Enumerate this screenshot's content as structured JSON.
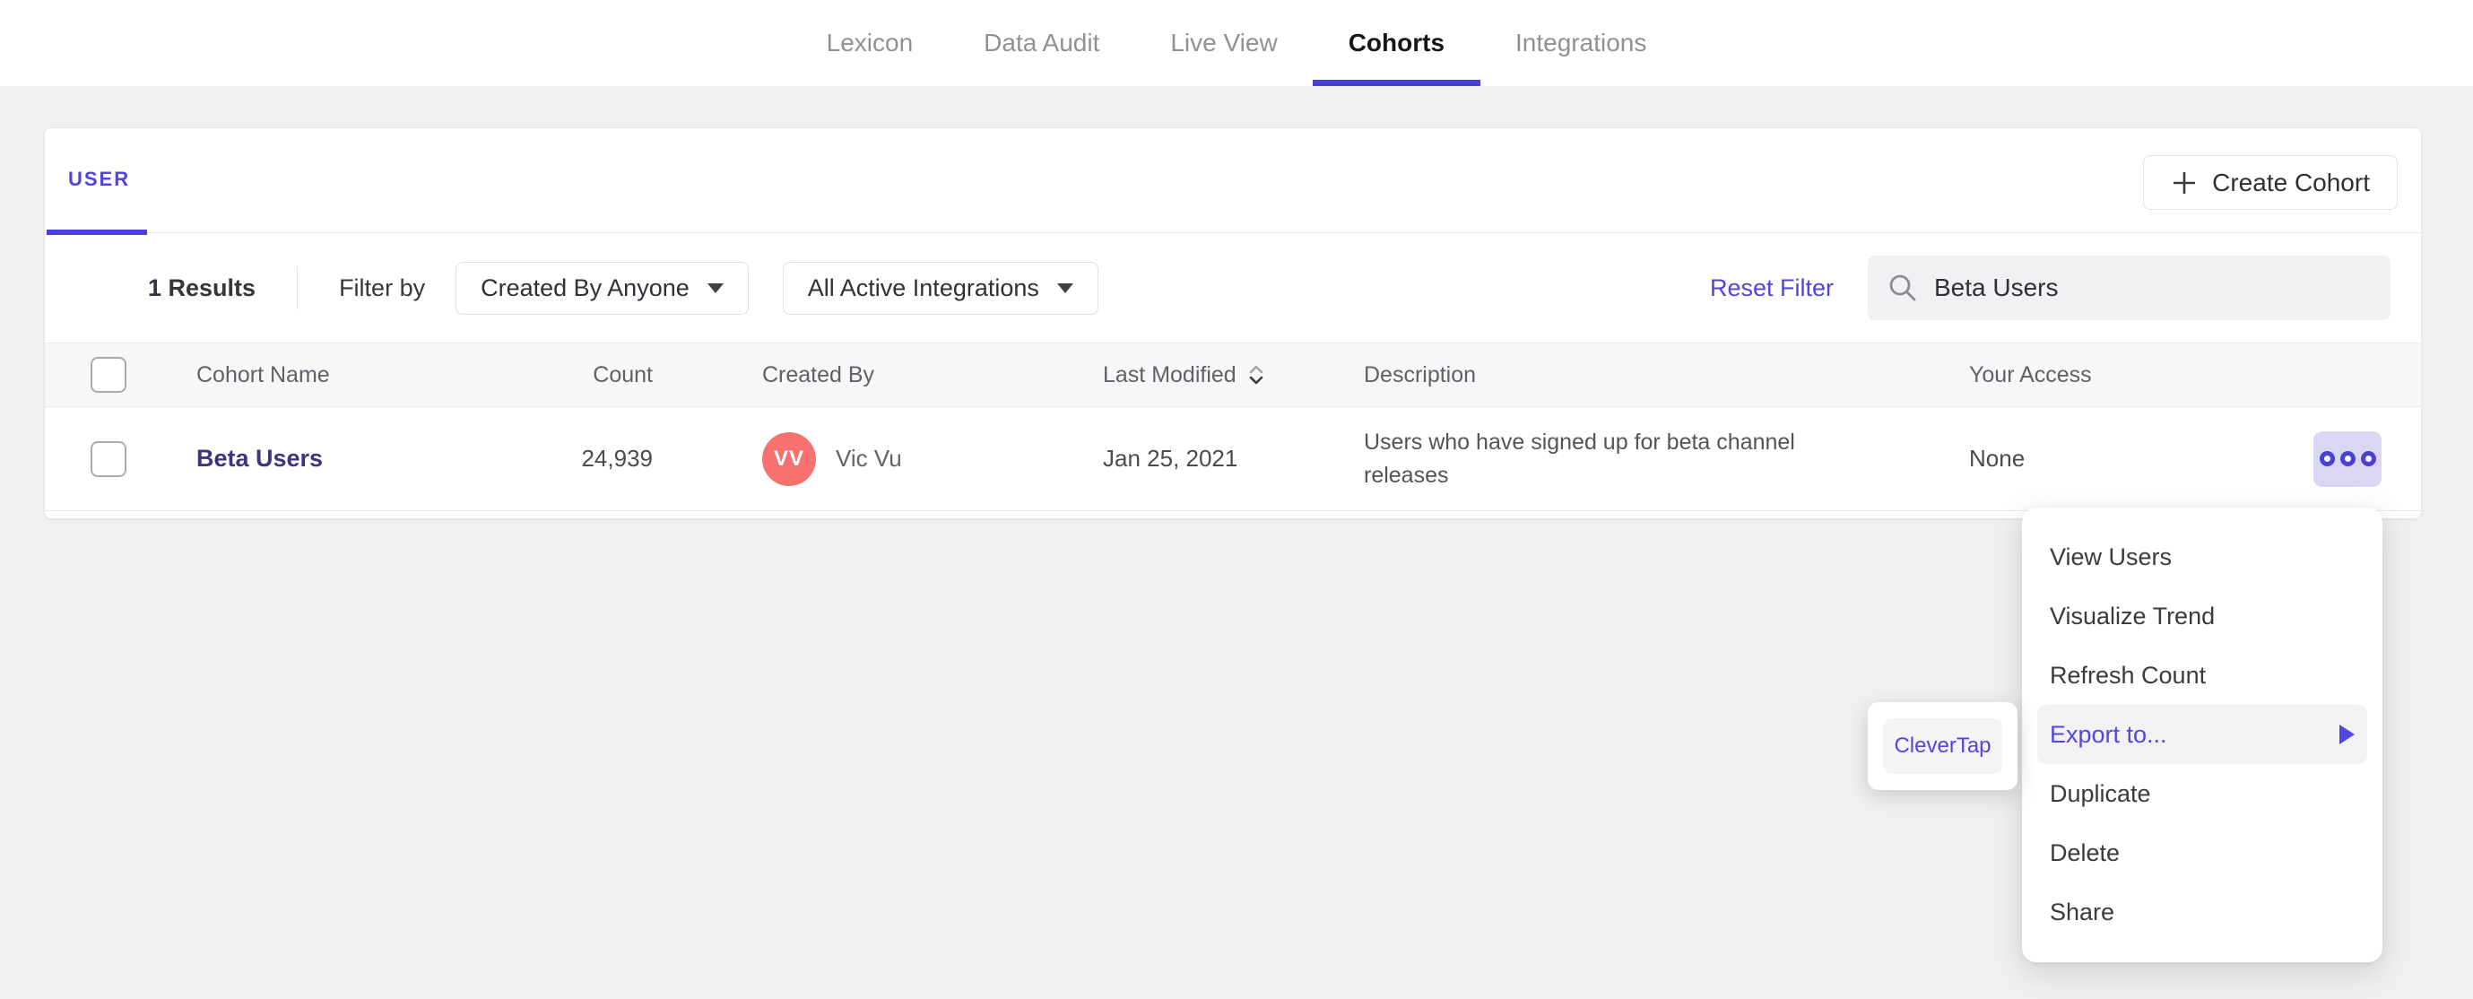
{
  "colors": {
    "accent": "#4f44e0",
    "active_underline": "#4b41d8",
    "cohort_link": "#3b3580",
    "avatar_bg": "#f7716e",
    "more_button_bg": "#d9d7f3",
    "page_bg": "#f0f0f2"
  },
  "nav": {
    "tabs": [
      {
        "label": "Lexicon"
      },
      {
        "label": "Data Audit"
      },
      {
        "label": "Live View"
      },
      {
        "label": "Cohorts"
      },
      {
        "label": "Integrations"
      }
    ]
  },
  "cohorts_panel": {
    "tab_label": "USER",
    "create_cohort_label": "Create Cohort",
    "filter_bar": {
      "results": "1 Results",
      "filter_by": "Filter by",
      "created_by_filter": "Created By Anyone",
      "integrations_filter": "All Active Integrations",
      "reset_filter": "Reset Filter",
      "search_value": "Beta Users"
    },
    "table": {
      "headers": {
        "name": "Cohort Name",
        "count": "Count",
        "created_by": "Created By",
        "last_modified": "Last Modified",
        "description": "Description",
        "access": "Your Access"
      },
      "rows": [
        {
          "name": "Beta Users",
          "count": "24,939",
          "avatar_initials": "VV",
          "created_by": "Vic Vu",
          "last_modified": "Jan 25, 2021",
          "description": "Users who have signed up for beta channel releases",
          "access": "None"
        }
      ]
    }
  },
  "context_menu": {
    "items": [
      "View Users",
      "Visualize Trend",
      "Refresh Count",
      "Export to...",
      "Duplicate",
      "Delete",
      "Share"
    ],
    "highlighted_item": "Export to..."
  },
  "export_submenu": {
    "items": [
      "CleverTap"
    ]
  }
}
